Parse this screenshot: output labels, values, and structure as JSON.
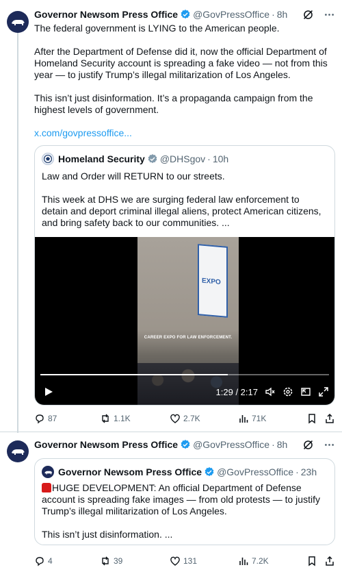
{
  "tweet1": {
    "author_name": "Governor Newsom Press Office",
    "handle": "@GovPressOffice",
    "dot": "·",
    "time": "8h",
    "paragraphs": [
      "The federal government is LYING to the American people.",
      "After the Department of Defense did it, now the official Department of Homeland Security account is spreading a fake video — not from this year — to justify Trump’s illegal militarization of Los Angeles.",
      "This isn’t just disinformation. It’s a propaganda campaign from the highest levels of government."
    ],
    "link": "x.com/govpressoffice...",
    "quote": {
      "author_name": "Homeland Security",
      "handle": "@DHSgov",
      "dot": "·",
      "time": "10h",
      "paragraphs": [
        "Law and Order will RETURN to our streets.",
        "This week at DHS we are surging federal law enforcement to detain and deport criminal illegal aliens, protect American citizens, and bring safety back to our communities. ..."
      ],
      "video": {
        "caption": "CAREER EXPO FOR LAW ENFORCEMENT.",
        "banner_text": "EXPO",
        "time_display": "1:29 / 2:17",
        "progress": 0.65
      }
    },
    "actions": {
      "replies": "87",
      "reposts": "1.1K",
      "likes": "2.7K",
      "views": "71K"
    }
  },
  "tweet2": {
    "author_name": "Governor Newsom Press Office",
    "handle": "@GovPressOffice",
    "dot": "·",
    "time": "8h",
    "quote": {
      "author_name": "Governor Newsom Press Office",
      "handle": "@GovPressOffice",
      "dot": "·",
      "time": "23h",
      "text": "HUGE DEVELOPMENT: An official Department of Defense account is spreading fake images — from old protests — to justify Trump’s illegal militarization of Los Angeles.",
      "text2": "This isn’t just disinformation. ..."
    },
    "actions": {
      "replies": "4",
      "reposts": "39",
      "likes": "131",
      "views": "7.2K"
    }
  },
  "colors": {
    "verified": "#1d9bf0",
    "link": "#1d9bf0",
    "secondary_text": "#536471",
    "border": "#cfd9de"
  },
  "icons": [
    "verified-badge-icon",
    "grok-icon",
    "more-icon",
    "reply-icon",
    "repost-icon",
    "like-icon",
    "views-icon",
    "bookmark-icon",
    "share-icon",
    "play-icon",
    "volume-icon",
    "settings-icon",
    "pip-icon",
    "fullscreen-icon"
  ]
}
